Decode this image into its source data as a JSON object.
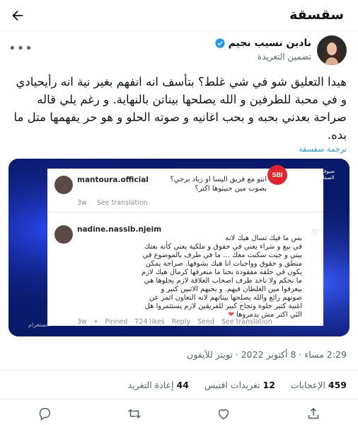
{
  "header": {
    "title": "سقسقة"
  },
  "author": {
    "name": "نادين نسيب نجيم",
    "subtitle": "تضمين التغريدة"
  },
  "tweet": {
    "text": "هيدا التعليق شو في شي غلط؟ بتأسف انه انفهم بغير نية انه رأيحيادي و في محبة للطرفين و الله يصلحها بيناتن بالنهاية. و رغم يلي قاله صراحة بعدني بحبه و بحب اغانيه و صوته الحلو و هو حر يفهمها متل ما بده.",
    "translate_label": "ترجمة سقسقة"
  },
  "media": {
    "channel_logo": "SBI",
    "channel_caption": "ضيوف زوارقي الصفاء والرضا",
    "corner_caption": "انستغرام",
    "comment1": {
      "user": "mantoura.official",
      "line1": "انتو مع فريق اليسا او زياد برجي؟",
      "line2": "بصوت مين حبيتوها اكتر؟",
      "age": "3w",
      "see_translation": "See translation"
    },
    "comment2": {
      "user": "nadine.nassib.njeim",
      "lines": [
        "بس ما فيك تسال هيك لانه",
        "في بيع و شراء يعني في حقوق و ملكية يعني كأنه بعتك",
        "بيتي و جيت سكنت معك ... ما في طرف بالموضوع في",
        "منطق و حقوق وواجبات انا هيك بشوفها. صراحة يمكن",
        "يكون في حلقة مفقودة نحنا ما منعرفها كرمال هيك لازم",
        "ما نحكم ولا ناخد طرف اصحاب العلاقة لازم يحلوها هي",
        "بيعرفوا مين الغلطان فيهم. و بحبهم الاتنين كتير و",
        "صوتهم رائع والله يصلحها بيناتهم لانه التعاون اثمر عن",
        "اغنية كتير حلوة ونجاح كبير للفريقين لازم يستثمروا هل",
        "النَي اكتر مش يدمروها"
      ],
      "age": "3w",
      "pinned": "Pinned",
      "likes": "724 likes",
      "reply": "Reply",
      "send": "Send",
      "see_translation": "See translation"
    }
  },
  "meta": {
    "time": "2:29 مساء",
    "date": "8 أكتوبر 2022",
    "source": "تويتر للآيفون"
  },
  "stats": {
    "likes_count": "459",
    "likes_label": "الإعجابات",
    "quotes_count": "12",
    "quotes_label": "تغريدات اقتبس",
    "retweets_count": "44",
    "retweets_label": "إعادة التغريد"
  },
  "colors": {
    "accent": "#1d9bf0",
    "text": "#0f1419",
    "muted": "#536471",
    "media_bg": "#0a1a6b"
  },
  "icons": [
    "back-arrow-icon",
    "verified-badge-icon",
    "more-icon",
    "reply-icon",
    "retweet-icon",
    "like-icon",
    "share-icon"
  ]
}
